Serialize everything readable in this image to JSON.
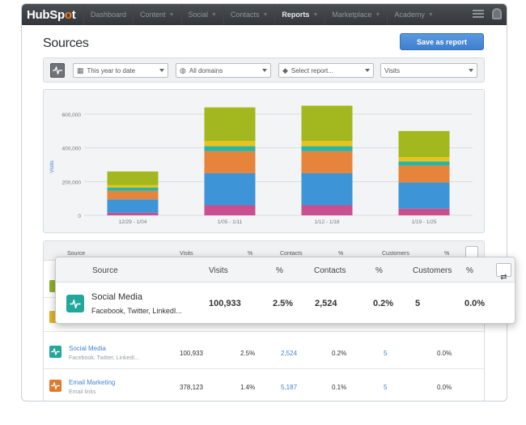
{
  "app": {
    "logo_pre": "HubSp",
    "logo_o": "o",
    "logo_post": "t"
  },
  "nav": {
    "items": [
      "Dashboard",
      "Content",
      "Social",
      "Contacts",
      "Reports",
      "Marketplace",
      "Academy"
    ],
    "active": "Reports"
  },
  "page": {
    "title": "Sources",
    "save_label": "Save as report"
  },
  "filters": {
    "date_range": "This year to date",
    "domains": "All domains",
    "report": "Select report...",
    "metric": "Visits"
  },
  "chart_data": {
    "type": "bar",
    "stacked": true,
    "categories": [
      "12/29 - 1/04",
      "1/05 - 1/11",
      "1/12 - 1/18",
      "1/19 - 1/25"
    ],
    "ylabel": "Visits",
    "ylim": [
      0,
      600000
    ],
    "yticks": [
      "0",
      "200,000",
      "400,000",
      "600,000"
    ],
    "grid": true,
    "series": [
      {
        "color": "#c9508e",
        "values": [
          15000,
          60000,
          60000,
          40000
        ]
      },
      {
        "color": "#3d94d6",
        "values": [
          80000,
          190000,
          190000,
          155000
        ]
      },
      {
        "color": "#e5843a",
        "values": [
          50000,
          130000,
          130000,
          100000
        ]
      },
      {
        "color": "#2cb3a2",
        "values": [
          20000,
          30000,
          30000,
          25000
        ]
      },
      {
        "color": "#e8c41a",
        "values": [
          15000,
          30000,
          30000,
          25000
        ]
      },
      {
        "color": "#a2b81e",
        "values": [
          80000,
          200000,
          210000,
          155000
        ]
      }
    ]
  },
  "table": {
    "headers": {
      "source": "Source",
      "visits": "Visits",
      "pct": "%",
      "contacts": "Contacts",
      "customers": "Customers"
    },
    "rows": [
      {
        "name": "Social Media",
        "sub": "Facebook, Twitter, LinkedI...",
        "visits": "100,933",
        "visits_pct": "2.5%",
        "contacts": "2,524",
        "contacts_pct": "0.2%",
        "customers": "5",
        "customers_pct": "0.0%",
        "color": "#22a89a"
      },
      {
        "name": "Email Marketing",
        "sub": "Email links",
        "visits": "378,123",
        "visits_pct": "1.4%",
        "contacts": "5,187",
        "contacts_pct": "0.1%",
        "customers": "5",
        "customers_pct": "0.0%",
        "color": "#e07b2e"
      }
    ]
  },
  "popup": {
    "name": "Social Media",
    "sub": "Facebook, Twitter, LinkedI...",
    "visits": "100,933",
    "visits_pct": "2.5%",
    "contacts": "2,524",
    "contacts_pct": "0.2%",
    "customers": "5",
    "customers_pct": "0.0%",
    "color": "#22a89a"
  }
}
